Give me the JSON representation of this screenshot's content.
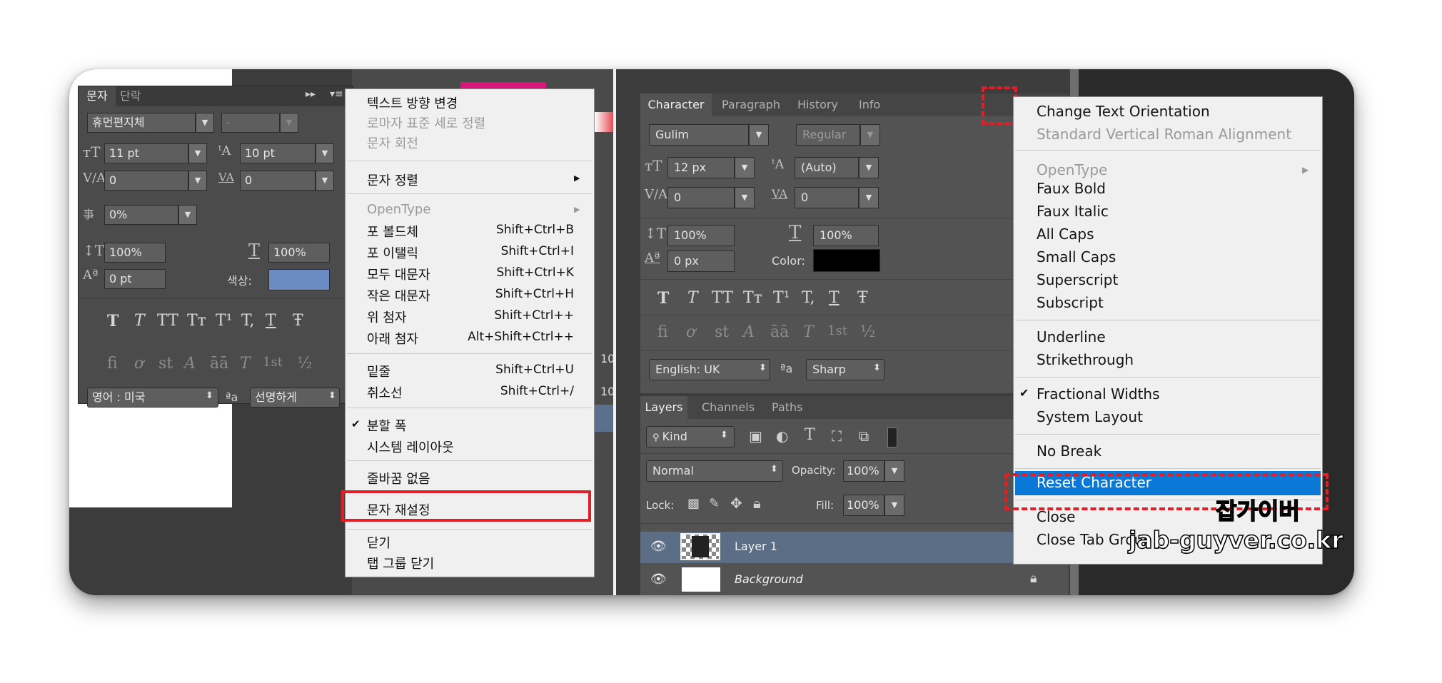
{
  "left_panel": {
    "tabs": [
      "문자",
      "단락"
    ],
    "font_family": "휴먼편지체",
    "font_style": "-",
    "font_size": "11 pt",
    "leading": "10 pt",
    "kerning": "0",
    "tracking": "0",
    "tsume": "0%",
    "vertical_scale": "100%",
    "horizontal_scale": "100%",
    "baseline_shift": "0 pt",
    "color_label": "색상:",
    "language": "영어 : 미국",
    "aa_label": "ªa",
    "antialias": "선명하게",
    "style_buttons": [
      "T",
      "T",
      "TT",
      "Tт",
      "T¹",
      "T,",
      "T",
      "Ŧ"
    ],
    "opentype_buttons": [
      "fi",
      "ơ",
      "st",
      "A",
      "āā",
      "T",
      "1st",
      "½"
    ],
    "color_swatch": "#6b8cc3"
  },
  "korean_menu": {
    "items": [
      {
        "label": "텍스트 방향 변경",
        "disabled": false
      },
      {
        "label": "로마자 표준 세로 정렬",
        "disabled": true
      },
      {
        "label": "문자 회전",
        "disabled": true
      },
      {
        "label": "문자 정렬",
        "submenu": true
      },
      {
        "label": "OpenType",
        "disabled": true,
        "submenu": true
      },
      {
        "label": "포 볼드체",
        "shortcut": "Shift+Ctrl+B"
      },
      {
        "label": "포 이탤릭",
        "shortcut": "Shift+Ctrl+I"
      },
      {
        "label": "모두 대문자",
        "shortcut": "Shift+Ctrl+K"
      },
      {
        "label": "작은 대문자",
        "shortcut": "Shift+Ctrl+H"
      },
      {
        "label": "위 첨자",
        "shortcut": "Shift+Ctrl++"
      },
      {
        "label": "아래 첨자",
        "shortcut": "Alt+Shift+Ctrl++"
      },
      {
        "label": "밑줄",
        "shortcut": "Shift+Ctrl+U"
      },
      {
        "label": "취소선",
        "shortcut": "Shift+Ctrl+/"
      },
      {
        "label": "분할 폭",
        "checked": true
      },
      {
        "label": "시스템 레이아웃"
      },
      {
        "label": "줄바꿈 없음"
      },
      {
        "label": "문자 재설정",
        "highlighted": true
      },
      {
        "label": "닫기"
      },
      {
        "label": "탭 그룹 닫기"
      }
    ],
    "checkmark": "✔",
    "submenu_arrow": "▶"
  },
  "background_bits": {
    "num1": "10",
    "num2": "10"
  },
  "character_panel": {
    "tabs": [
      "Character",
      "Paragraph",
      "History",
      "Info"
    ],
    "font_family": "Gulim",
    "font_style": "Regular",
    "font_size": "12 px",
    "leading": "(Auto)",
    "kerning": "0",
    "tracking": "0",
    "vertical_scale": "100%",
    "horizontal_scale": "100%",
    "baseline_shift": "0 px",
    "color_label": "Color:",
    "language": "English: UK",
    "aa_label": "ªa",
    "antialias": "Sharp",
    "style_buttons": [
      "T",
      "T",
      "TT",
      "Tт",
      "T¹",
      "T,",
      "T",
      "Ŧ"
    ],
    "opentype_buttons": [
      "fi",
      "ơ",
      "st",
      "A",
      "āā",
      "T",
      "1st",
      "½"
    ],
    "color_swatch": "#000000"
  },
  "layers_panel": {
    "tabs": [
      "Layers",
      "Channels",
      "Paths"
    ],
    "filter_kind": "Kind",
    "blend_mode": "Normal",
    "opacity_label": "Opacity:",
    "opacity": "100%",
    "lock_label": "Lock:",
    "fill_label": "Fill:",
    "fill": "100%",
    "layers": [
      {
        "name": "Layer 1",
        "selected": true
      },
      {
        "name": "Background",
        "locked": true
      }
    ]
  },
  "english_menu": {
    "items": [
      {
        "label": "Change Text Orientation"
      },
      {
        "label": "Standard Vertical Roman Alignment",
        "disabled": true
      },
      {
        "label": "OpenType",
        "disabled": true,
        "submenu": true
      },
      {
        "label": "Faux Bold"
      },
      {
        "label": "Faux Italic"
      },
      {
        "label": "All Caps"
      },
      {
        "label": "Small Caps"
      },
      {
        "label": "Superscript"
      },
      {
        "label": "Subscript"
      },
      {
        "label": "Underline"
      },
      {
        "label": "Strikethrough"
      },
      {
        "label": "Fractional Widths",
        "checked": true
      },
      {
        "label": "System Layout"
      },
      {
        "label": "No Break"
      },
      {
        "label": "Reset Character",
        "highlighted": true
      },
      {
        "label": "Close"
      },
      {
        "label": "Close Tab Group"
      }
    ],
    "highlight_color": "#0a78d7"
  },
  "watermark": {
    "korean": "잡가이버",
    "url": "jab-guyver.co.kr"
  },
  "colors": {
    "annotation_red": "#e21e26",
    "panel_dark": "#4b4b4b"
  }
}
